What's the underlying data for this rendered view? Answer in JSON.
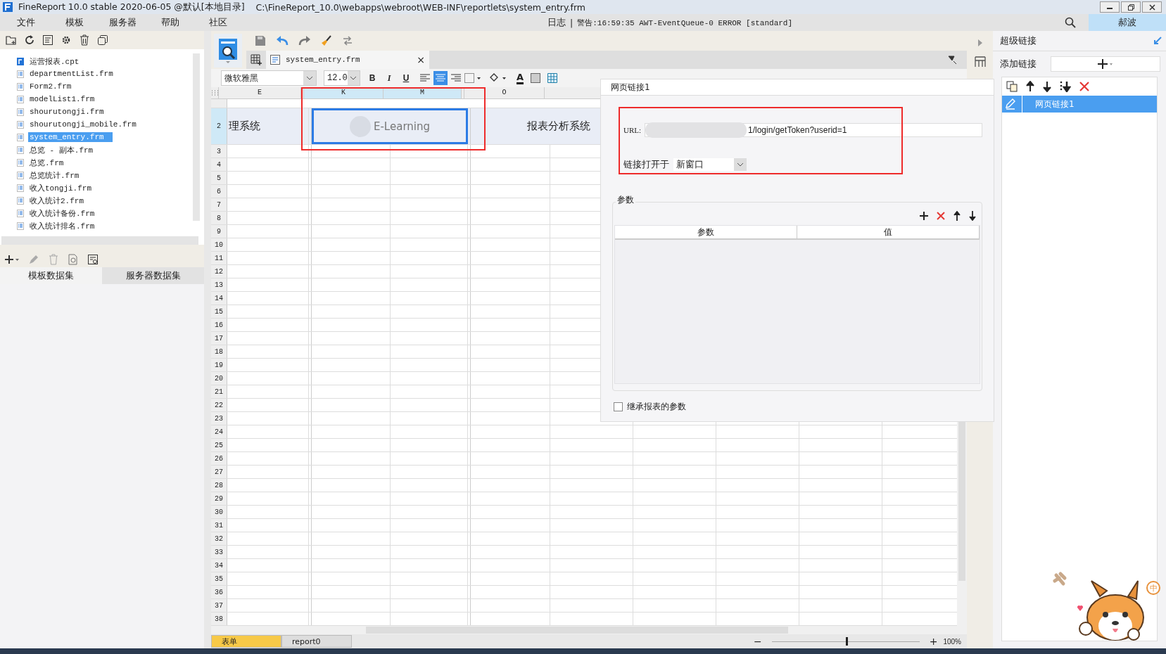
{
  "window": {
    "title": "FineReport 10.0 stable 2020-06-05 @默认[本地目录]",
    "path": "C:\\FineReport_10.0\\webapps\\webroot\\WEB-INF\\reportlets\\system_entry.frm"
  },
  "menu": [
    "文件",
    "模板",
    "服务器",
    "帮助",
    "社区"
  ],
  "status": {
    "log": "日志",
    "separator": "|",
    "warning": "警告:16:59:35 AWT-EventQueue-0 ERROR [standard]"
  },
  "user": "郝波",
  "file_tree": [
    {
      "name": "运营报表.cpt",
      "kind": "cpt",
      "selected": false
    },
    {
      "name": "departmentList.frm",
      "kind": "frm",
      "selected": false
    },
    {
      "name": "Form2.frm",
      "kind": "frm",
      "selected": false
    },
    {
      "name": "modelList1.frm",
      "kind": "frm",
      "selected": false
    },
    {
      "name": "shourutongji.frm",
      "kind": "frm",
      "selected": false
    },
    {
      "name": "shourutongji_mobile.frm",
      "kind": "frm",
      "selected": false
    },
    {
      "name": "system_entry.frm",
      "kind": "frm",
      "selected": true
    },
    {
      "name": "总览 - 副本.frm",
      "kind": "frm",
      "selected": false
    },
    {
      "name": "总览.frm",
      "kind": "frm",
      "selected": false
    },
    {
      "name": "总览统计.frm",
      "kind": "frm",
      "selected": false
    },
    {
      "name": "收入tongji.frm",
      "kind": "frm",
      "selected": false
    },
    {
      "name": "收入统计2.frm",
      "kind": "frm",
      "selected": false
    },
    {
      "name": "收入统计备份.frm",
      "kind": "frm",
      "selected": false
    },
    {
      "name": "收入统计排名.frm",
      "kind": "frm",
      "selected": false
    }
  ],
  "dataset_tabs": [
    {
      "label": "模板数据集",
      "selected": true
    },
    {
      "label": "服务器数据集",
      "selected": false
    }
  ],
  "editor_tab": {
    "label": "system_entry.frm",
    "close": "×"
  },
  "format": {
    "font": "微软雅黑",
    "size": "12.0",
    "styles": [
      "B",
      "I",
      "U"
    ],
    "align": [
      {
        "kind": "left",
        "selected": false
      },
      {
        "kind": "center",
        "selected": true
      },
      {
        "kind": "right",
        "selected": false
      }
    ],
    "font_color": "A"
  },
  "sheet": {
    "columns": [
      "E",
      "K",
      "M",
      "O"
    ],
    "row_numbers": [
      "2",
      "3",
      "4",
      "5",
      "6",
      "7",
      "8",
      "9",
      "10",
      "11",
      "12",
      "13",
      "14",
      "15",
      "16",
      "17",
      "18",
      "19",
      "20",
      "21",
      "22",
      "23",
      "24",
      "25",
      "26",
      "27",
      "28",
      "29",
      "30",
      "31",
      "32",
      "33",
      "34",
      "35",
      "36",
      "37",
      "38"
    ],
    "row2": {
      "E": "理系统",
      "KM": "E-Learning",
      "O": "报表分析系统"
    }
  },
  "hyperlink_dialog": {
    "title": "网页链接1",
    "url_label": "URL:",
    "url_value": "1/login/getToken?userid=1",
    "open_in_label": "链接打开于",
    "open_in_value": "新窗口",
    "params_label": "参数",
    "params_columns": [
      "参数",
      "值"
    ],
    "inherit_label": "继承报表的参数",
    "inherit_checked": false
  },
  "right_panel": {
    "title": "超级链接",
    "add_label": "添加链接",
    "links": [
      {
        "label": "网页链接1",
        "selected": true
      }
    ]
  },
  "sheets": [
    {
      "label": "表单",
      "selected": true
    },
    {
      "label": "report0",
      "selected": false
    }
  ],
  "zoom": {
    "out": "−",
    "in": "+",
    "level": 0.5,
    "reading": "100%"
  },
  "ime": "中"
}
